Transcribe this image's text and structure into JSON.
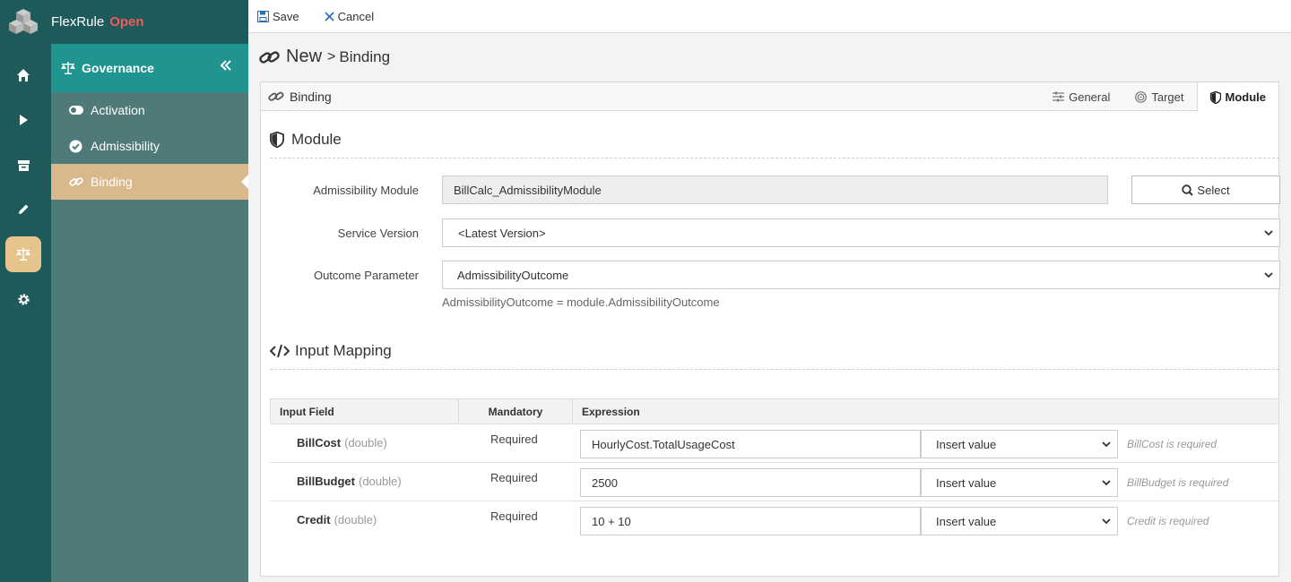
{
  "app": {
    "name": "FlexRule",
    "edition": "Open"
  },
  "toolbar": {
    "save_label": "Save",
    "cancel_label": "Cancel"
  },
  "sidebar": {
    "title": "Governance",
    "items": [
      {
        "label": "Activation"
      },
      {
        "label": "Admissibility"
      },
      {
        "label": "Binding"
      }
    ]
  },
  "breadcrumb": {
    "root": "New",
    "separator": ">",
    "current": "Binding"
  },
  "card": {
    "title": "Binding",
    "tabs": [
      {
        "label": "General",
        "icon": "sliders-icon"
      },
      {
        "label": "Target",
        "icon": "target-icon"
      },
      {
        "label": "Module",
        "icon": "shield-icon"
      }
    ],
    "active_tab": "Module"
  },
  "module_section": {
    "title": "Module",
    "admissibility_module_label": "Admissibility Module",
    "admissibility_module_value": "BillCalc_AdmissibilityModule",
    "select_label": "Select",
    "service_version_label": "Service Version",
    "service_version_value": "<Latest Version>",
    "outcome_parameter_label": "Outcome Parameter",
    "outcome_parameter_value": "AdmissibilityOutcome",
    "outcome_hint": "AdmissibilityOutcome = module.AdmissibilityOutcome"
  },
  "input_mapping": {
    "title": "Input Mapping",
    "columns": [
      "Input Field",
      "Mandatory",
      "Expression"
    ],
    "rows": [
      {
        "field": "BillCost",
        "type": "(double)",
        "mandatory": "Required",
        "expression": "HourlyCost.TotalUsageCost",
        "insert": "Insert value",
        "error": "BillCost is required"
      },
      {
        "field": "BillBudget",
        "type": "(double)",
        "mandatory": "Required",
        "expression": "2500",
        "insert": "Insert value",
        "error": "BillBudget is required"
      },
      {
        "field": "Credit",
        "type": "(double)",
        "mandatory": "Required",
        "expression": "10 + 10",
        "insert": "Insert value",
        "error": "Credit is required"
      }
    ]
  },
  "colors": {
    "rail": "#1e5a5a",
    "sidebar": "#4e7a7a",
    "sidebar_head": "#1f9490",
    "active_item": "#d9b98c",
    "brand_open": "#f05b5b"
  }
}
